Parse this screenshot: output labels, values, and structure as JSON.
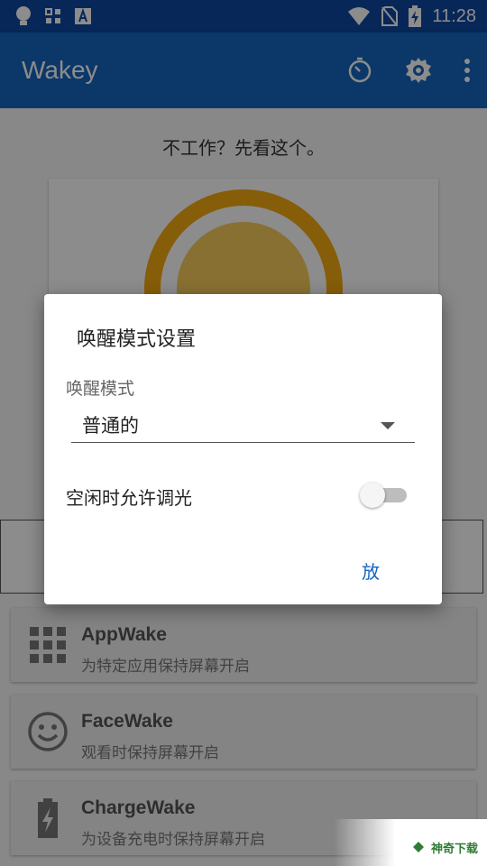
{
  "status_bar": {
    "time": "11:28",
    "icons": [
      "lightbulb-icon",
      "grid-icon",
      "text-a-icon",
      "wifi-icon",
      "no-sim-icon",
      "battery-charging-icon"
    ]
  },
  "app_bar": {
    "title": "Wakey",
    "actions": [
      "timer-icon",
      "settings-icon",
      "more-vert-icon"
    ]
  },
  "main": {
    "hint": "不工作？先看这个。"
  },
  "features": [
    {
      "icon": "apps-grid-icon",
      "name": "AppWake",
      "desc": "为特定应用保持屏幕开启"
    },
    {
      "icon": "smiley-face-icon",
      "name": "FaceWake",
      "desc": "观看时保持屏幕开启"
    },
    {
      "icon": "battery-charging-icon",
      "name": "ChargeWake",
      "desc": "为设备充电时保持屏幕开启"
    }
  ],
  "dialog": {
    "title": "唤醒模式设置",
    "mode_label": "唤醒模式",
    "mode_value": "普通的",
    "dim_label": "空闲时允许调光",
    "dim_enabled": false,
    "ok_label": "放"
  },
  "watermark": {
    "text": "神奇下载"
  },
  "colors": {
    "status_bar": "#0d47a1",
    "app_bar": "#1565c0",
    "ring": "#f4a911",
    "sun": "#f7cc5c",
    "accent": "#1565c0"
  }
}
